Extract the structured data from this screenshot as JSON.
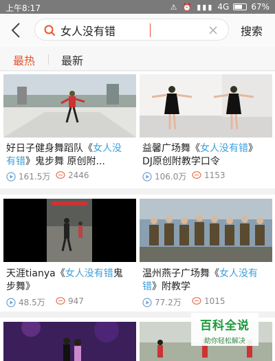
{
  "status": {
    "time": "上午8:17",
    "network": "4G",
    "battery": "67%"
  },
  "search": {
    "query": "女人没有错",
    "button_label": "搜索"
  },
  "tabs": [
    {
      "label": "最热",
      "active": true
    },
    {
      "label": "最新",
      "active": false
    }
  ],
  "colors": {
    "accent": "#e8542a",
    "highlight": "#3aa0dc",
    "meta": "#888888"
  },
  "videos": [
    {
      "title_pre": "好日子健身舞蹈队《",
      "title_hl": "女人没有错",
      "title_post": "》鬼步舞 原创附...",
      "plays": "161.5万",
      "comments": "2446"
    },
    {
      "title_pre": "益馨广场舞《",
      "title_hl": "女人没有错",
      "title_post": "》DJ原创附教学口令",
      "plays": "106.0万",
      "comments": "1153"
    },
    {
      "title_pre": "天涯tianya《",
      "title_hl": "女人没有错",
      "title_post": "鬼步舞》",
      "plays": "48.5万",
      "comments": "947"
    },
    {
      "title_pre": "温州燕子广场舞《",
      "title_hl": "女人没有错",
      "title_post": "》附教学",
      "plays": "77.2万",
      "comments": "1015"
    }
  ],
  "watermark": {
    "main": "百科全说",
    "sub": "助你轻松解决"
  }
}
